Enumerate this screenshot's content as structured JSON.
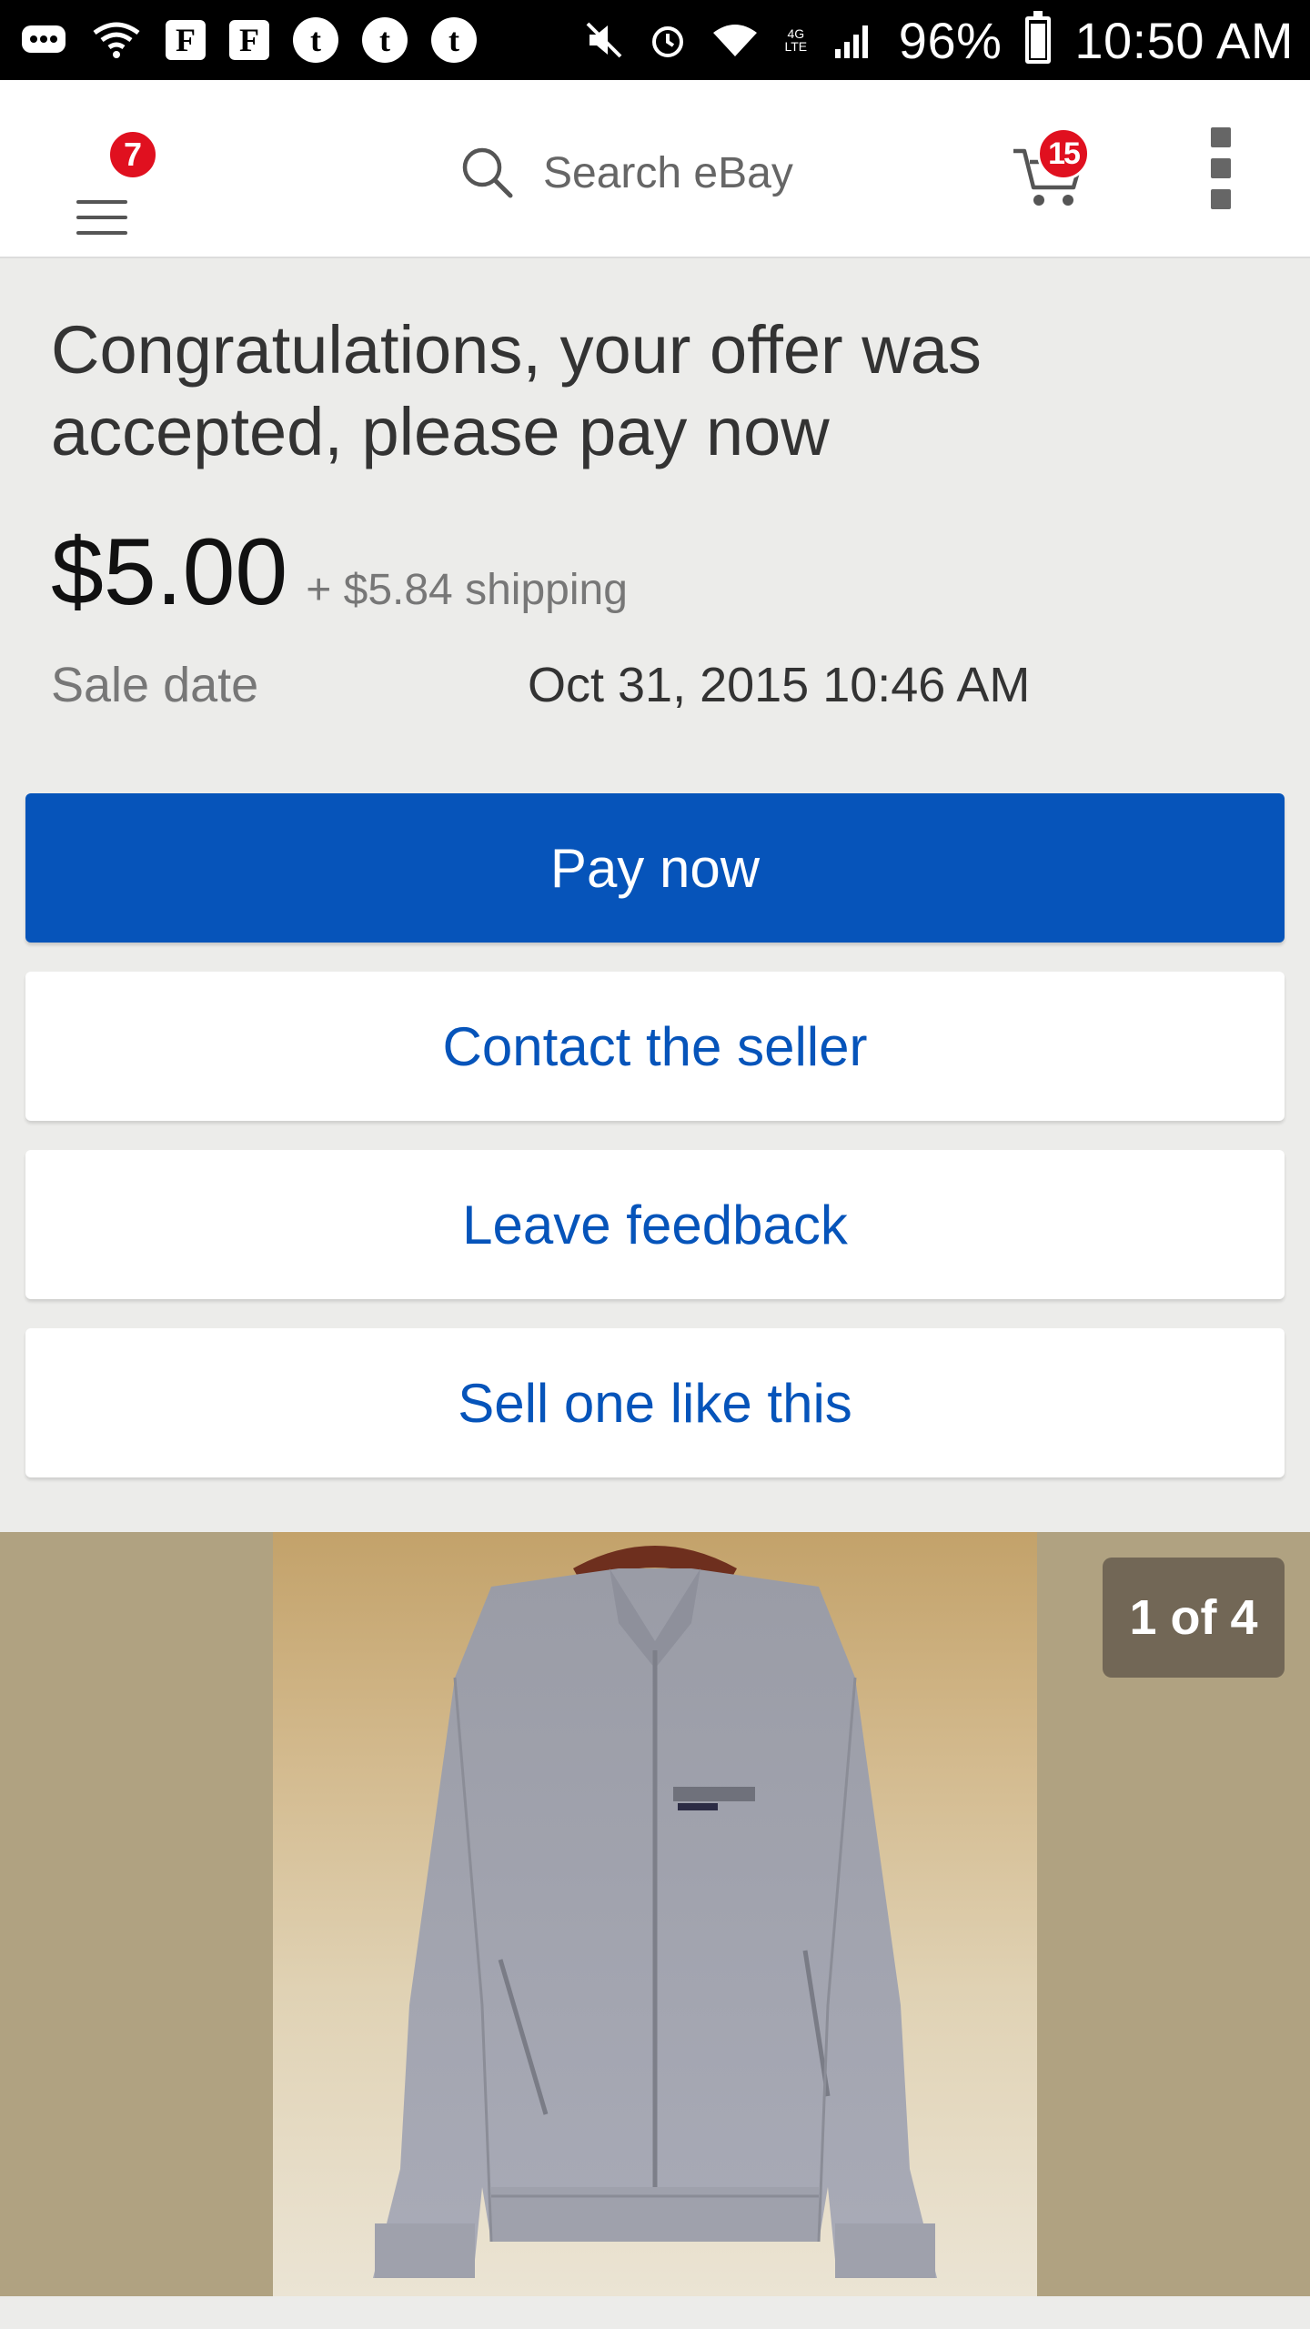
{
  "status_bar": {
    "battery": "96%",
    "time": "10:50 AM",
    "network": "4G LTE",
    "icons": [
      "chat-icon",
      "wifi-icon",
      "flipboard-icon",
      "flipboard-icon",
      "tumblr-icon",
      "tumblr-icon",
      "tumblr-icon",
      "mute-icon",
      "alarm-icon",
      "wifi-icon",
      "network-icon",
      "signal-icon",
      "battery-icon"
    ]
  },
  "header": {
    "menu_badge": "7",
    "search_placeholder": "Search eBay",
    "cart_badge": "15"
  },
  "main": {
    "headline": "Congratulations, your offer was accepted, please pay now",
    "price": "$5.00",
    "shipping": "+ $5.84 shipping",
    "sale_label": "Sale date",
    "sale_value": "Oct 31, 2015 10:46 AM"
  },
  "buttons": {
    "pay_now": "Pay now",
    "contact_seller": "Contact the seller",
    "leave_feedback": "Leave feedback",
    "sell_one": "Sell one like this"
  },
  "gallery": {
    "counter": "1 of 4"
  },
  "colors": {
    "primary": "#0654ba",
    "badge": "#e0101f",
    "background": "#ececea"
  }
}
